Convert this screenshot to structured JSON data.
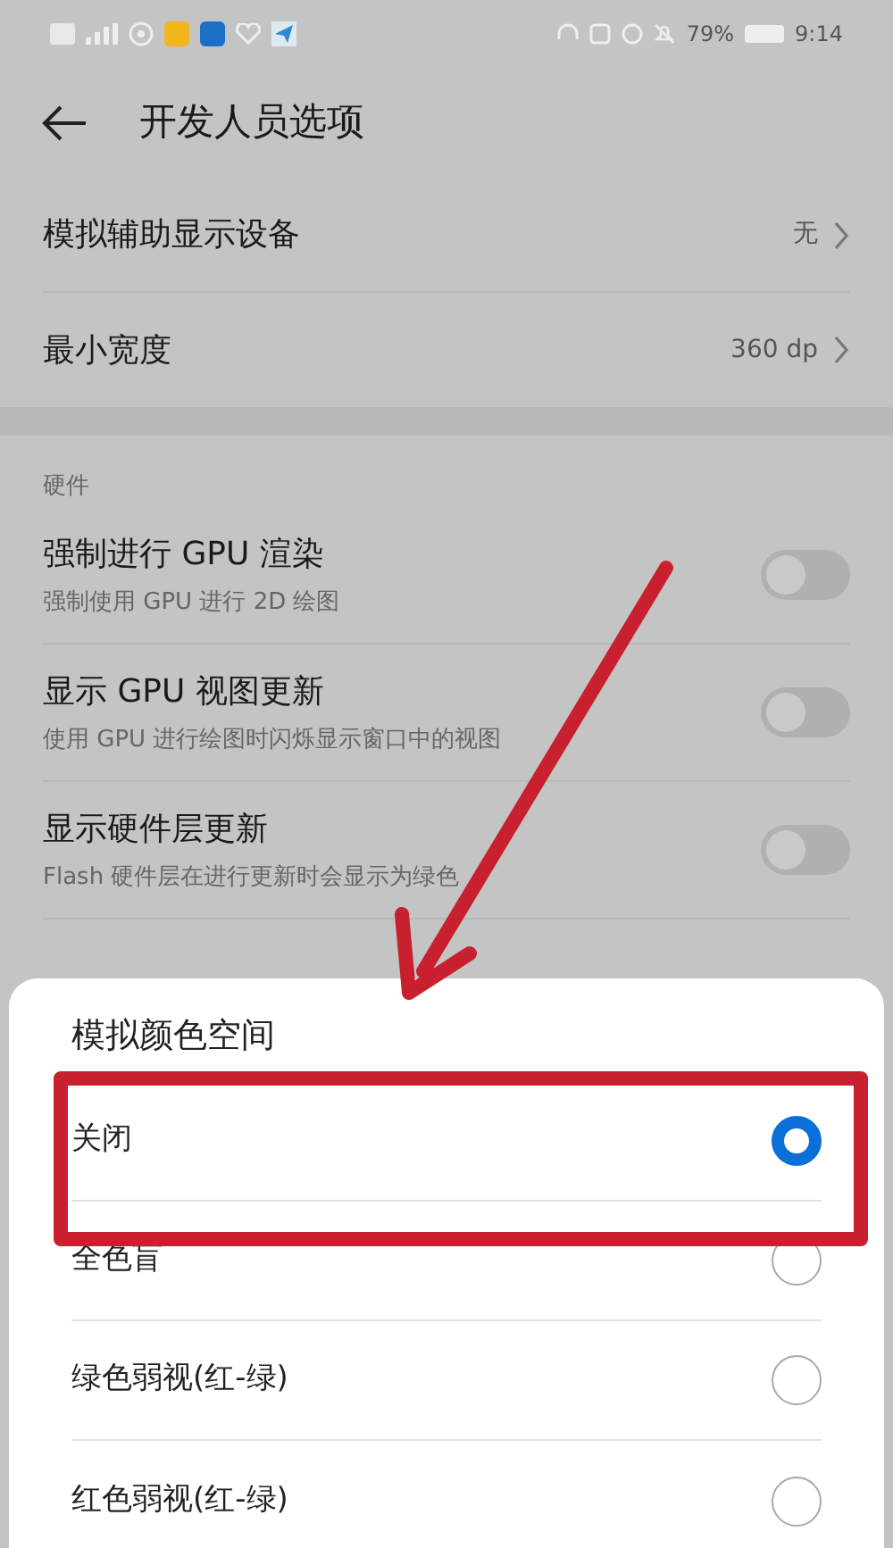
{
  "status_bar": {
    "battery": "79%",
    "time": "9:14"
  },
  "header": {
    "title": "开发人员选项"
  },
  "settings": [
    {
      "label": "模拟辅助显示设备",
      "value": "无"
    },
    {
      "label": "最小宽度",
      "value": "360 dp"
    }
  ],
  "section": {
    "title": "硬件",
    "toggles": [
      {
        "label": "强制进行 GPU 渲染",
        "description": "强制使用 GPU 进行 2D 绘图",
        "on": false
      },
      {
        "label": "显示 GPU 视图更新",
        "description": "使用 GPU 进行绘图时闪烁显示窗口中的视图",
        "on": false
      },
      {
        "label": "显示硬件层更新",
        "description": "Flash 硬件层在进行更新时会显示为绿色",
        "on": false
      }
    ]
  },
  "dialog": {
    "title": "模拟颜色空间",
    "options": [
      {
        "label": "关闭",
        "selected": true
      },
      {
        "label": "全色盲",
        "selected": false
      },
      {
        "label": "绿色弱视(红-绿)",
        "selected": false
      },
      {
        "label": "红色弱视(红-绿)",
        "selected": false
      }
    ]
  }
}
